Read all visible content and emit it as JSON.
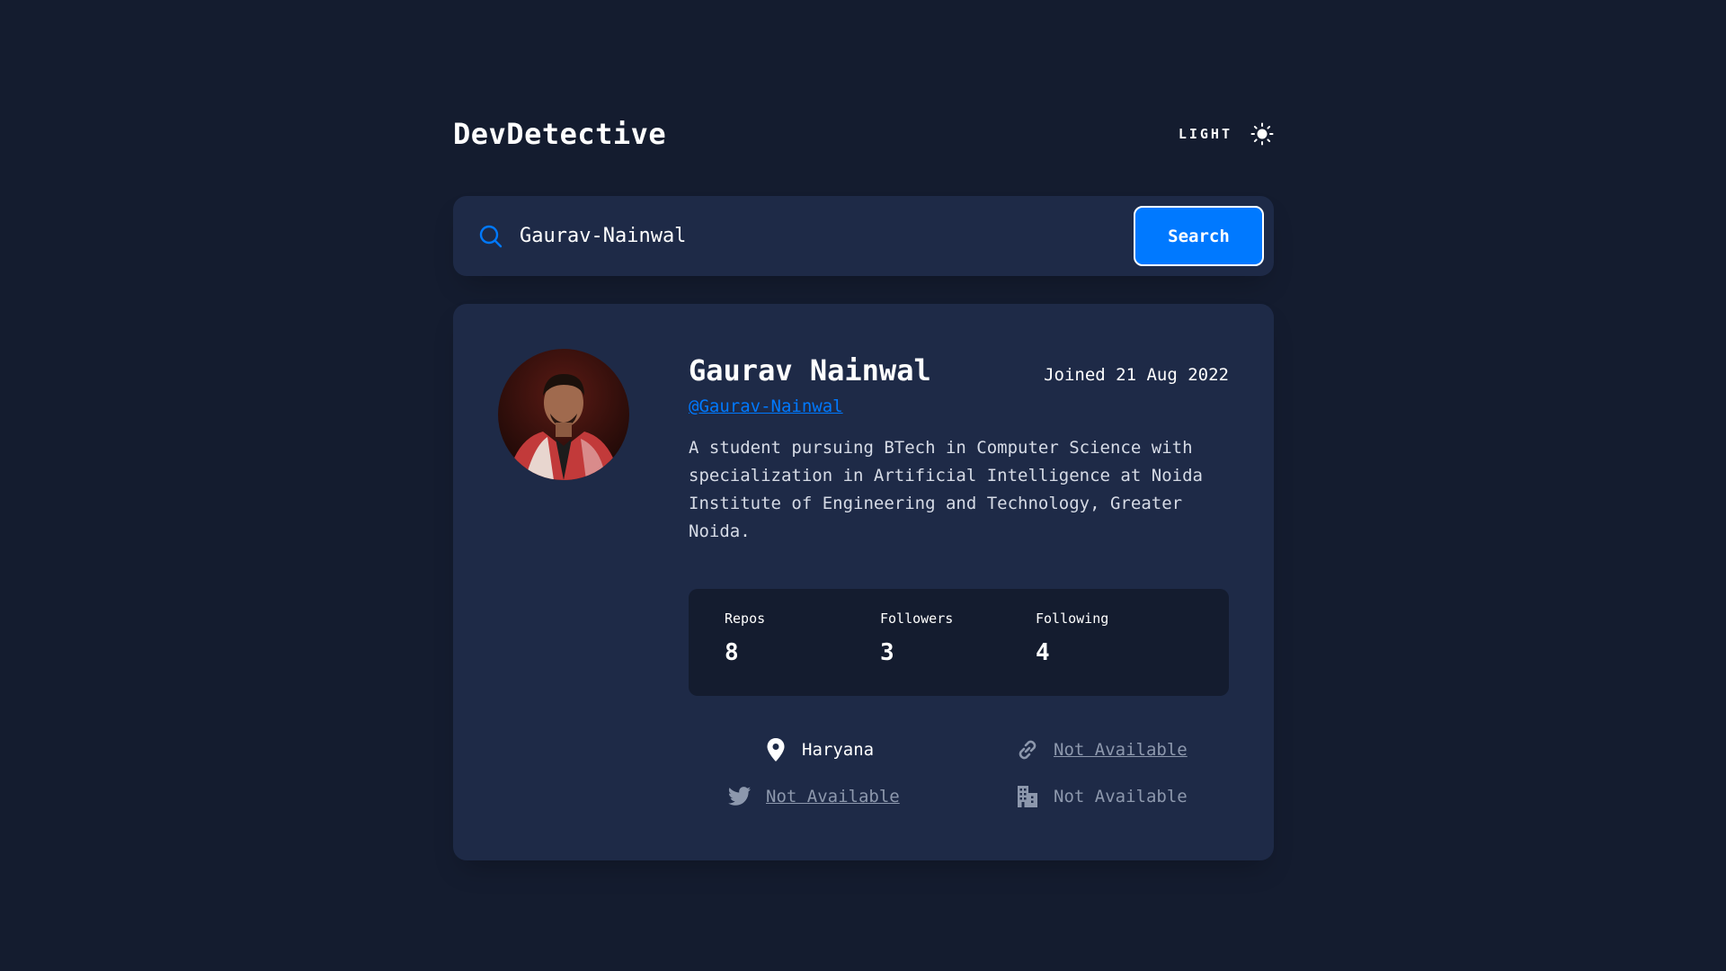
{
  "app": {
    "title": "DevDetective"
  },
  "theme_toggle": {
    "label": "LIGHT",
    "icon": "sun-icon"
  },
  "search": {
    "value": "Gaurav-Nainwal",
    "button_label": "Search",
    "icon": "search-icon"
  },
  "profile": {
    "name": "Gaurav Nainwal",
    "joined": "Joined 21 Aug 2022",
    "username": "@Gaurav-Nainwal",
    "bio": "A student pursuing BTech in Computer Science with specialization in Artificial Intelligence at Noida Institute of Engineering and Technology, Greater Noida.",
    "stats": [
      {
        "label": "Repos",
        "value": "8"
      },
      {
        "label": "Followers",
        "value": "3"
      },
      {
        "label": "Following",
        "value": "4"
      }
    ],
    "links": {
      "location": "Haryana",
      "website": "Not Available",
      "twitter": "Not Available",
      "company": "Not Available"
    }
  },
  "colors": {
    "background": "#141c2f",
    "card": "#1e2a47",
    "accent": "#0079ff",
    "muted": "#8d98ad"
  }
}
